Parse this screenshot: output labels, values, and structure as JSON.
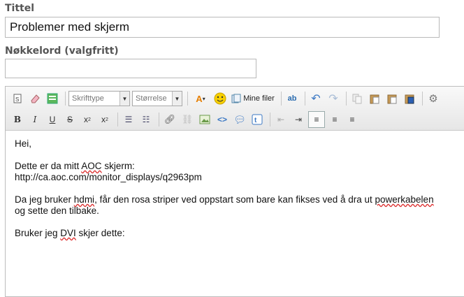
{
  "form": {
    "title_label": "Tittel",
    "title_value": "Problemer med skjerm",
    "keywords_label": "Nøkkelord (valgfritt)",
    "keywords_value": ""
  },
  "toolbar": {
    "font_family_placeholder": "Skrifttype",
    "font_size_placeholder": "Størrelse",
    "my_files_label": "Mine filer",
    "bold": "B",
    "italic": "I",
    "underline": "U",
    "strike": "S",
    "subscript": "x",
    "subscript_sub": "2",
    "superscript": "x",
    "superscript_sup": "2"
  },
  "content": {
    "line1": "Hei,",
    "line2a": "Dette er da mitt ",
    "line2_spell": "AOC",
    "line2b": " skjerm:",
    "line3": "http://ca.aoc.com/monitor_displays/q2963pm",
    "line4a": "Da jeg bruker ",
    "line4_spell1": "hdmi",
    "line4b": ", får den rosa striper ved oppstart som bare kan fikses ved å dra ut ",
    "line4_spell2": "powerkabelen",
    "line5": "og sette den tilbake.",
    "line6a": "Bruker jeg ",
    "line6_spell": "DVI",
    "line6b": " skjer dette:"
  }
}
